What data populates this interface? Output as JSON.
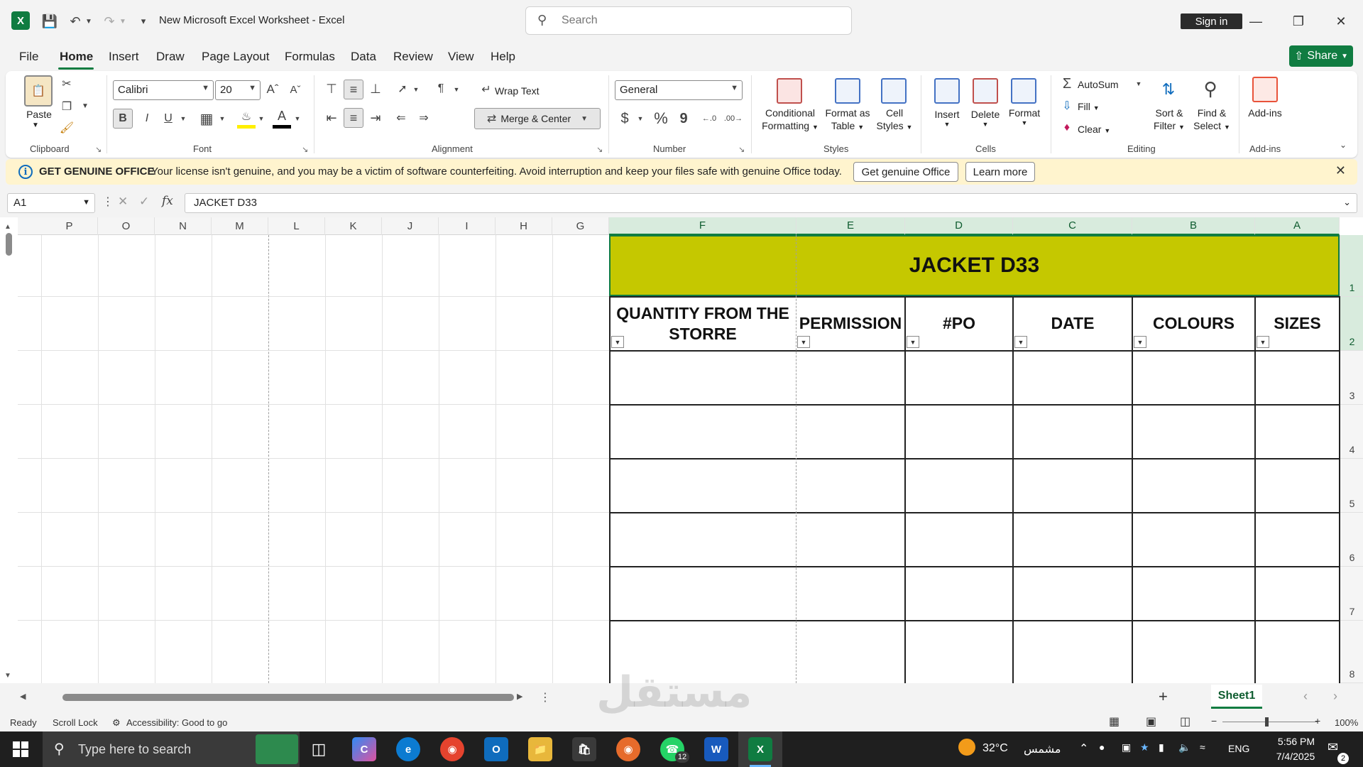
{
  "titlebar": {
    "doc_title": "New Microsoft Excel Worksheet  -  Excel",
    "search_placeholder": "Search",
    "signin_label": "Sign in"
  },
  "menu": {
    "tabs": [
      "File",
      "Home",
      "Insert",
      "Draw",
      "Page Layout",
      "Formulas",
      "Data",
      "Review",
      "View",
      "Help"
    ],
    "active": "Home",
    "share_label": "Share"
  },
  "ribbon": {
    "clipboard": {
      "paste": "Paste",
      "group": "Clipboard"
    },
    "font": {
      "name": "Calibri",
      "size": "20",
      "bold": "B",
      "italic": "I",
      "underline": "U",
      "group": "Font"
    },
    "alignment": {
      "wrap_text": "Wrap Text",
      "merge_center": "Merge & Center",
      "group": "Alignment"
    },
    "number": {
      "format": "General",
      "currency": "$",
      "percent": "%",
      "comma": "9",
      "group": "Number"
    },
    "styles": {
      "conditional": [
        "Conditional",
        "Formatting"
      ],
      "format_table": [
        "Format as",
        "Table"
      ],
      "cell_styles": [
        "Cell",
        "Styles"
      ],
      "group": "Styles"
    },
    "cells": {
      "insert": "Insert",
      "delete": "Delete",
      "format": "Format",
      "group": "Cells"
    },
    "editing": {
      "autosum": "AutoSum",
      "fill": "Fill",
      "clear": "Clear",
      "sort": [
        "Sort &",
        "Filter"
      ],
      "find": [
        "Find &",
        "Select"
      ],
      "group": "Editing"
    },
    "addins": {
      "label": "Add-ins",
      "group": "Add-ins"
    }
  },
  "notice": {
    "title": "GET GENUINE OFFICE",
    "message": "Your license isn't genuine, and you may be a victim of software counterfeiting. Avoid interruption and keep your files safe with genuine Office today.",
    "btn_genuine": "Get genuine Office",
    "btn_learn": "Learn more"
  },
  "formula_bar": {
    "namebox": "A1",
    "fx": "fx",
    "value": "JACKET D33"
  },
  "grid": {
    "columns": [
      "P",
      "O",
      "N",
      "M",
      "L",
      "K",
      "J",
      "I",
      "H",
      "G",
      "F",
      "E",
      "D",
      "C",
      "B",
      "A"
    ],
    "rows": [
      "1",
      "2",
      "3",
      "4",
      "5",
      "6",
      "7",
      "8"
    ],
    "title": "JACKET D33",
    "headers": [
      "QUANTITY FROM THE STORRE",
      "PERMISSION",
      "#PO",
      "DATE",
      "COLOURS",
      "SIZES"
    ]
  },
  "sheets": {
    "active": "Sheet1"
  },
  "status": {
    "ready": "Ready",
    "scroll_lock": "Scroll Lock",
    "accessibility": "Accessibility: Good to go",
    "zoom": "100%"
  },
  "taskbar": {
    "search_placeholder": "Type here to search",
    "temperature": "32°C",
    "weather": "مشمس",
    "lang": "ENG",
    "time": "5:56 PM",
    "date": "7/4/2025",
    "whatsapp_badge": "12",
    "notif_badge": "2"
  },
  "watermark": "مستقل"
}
